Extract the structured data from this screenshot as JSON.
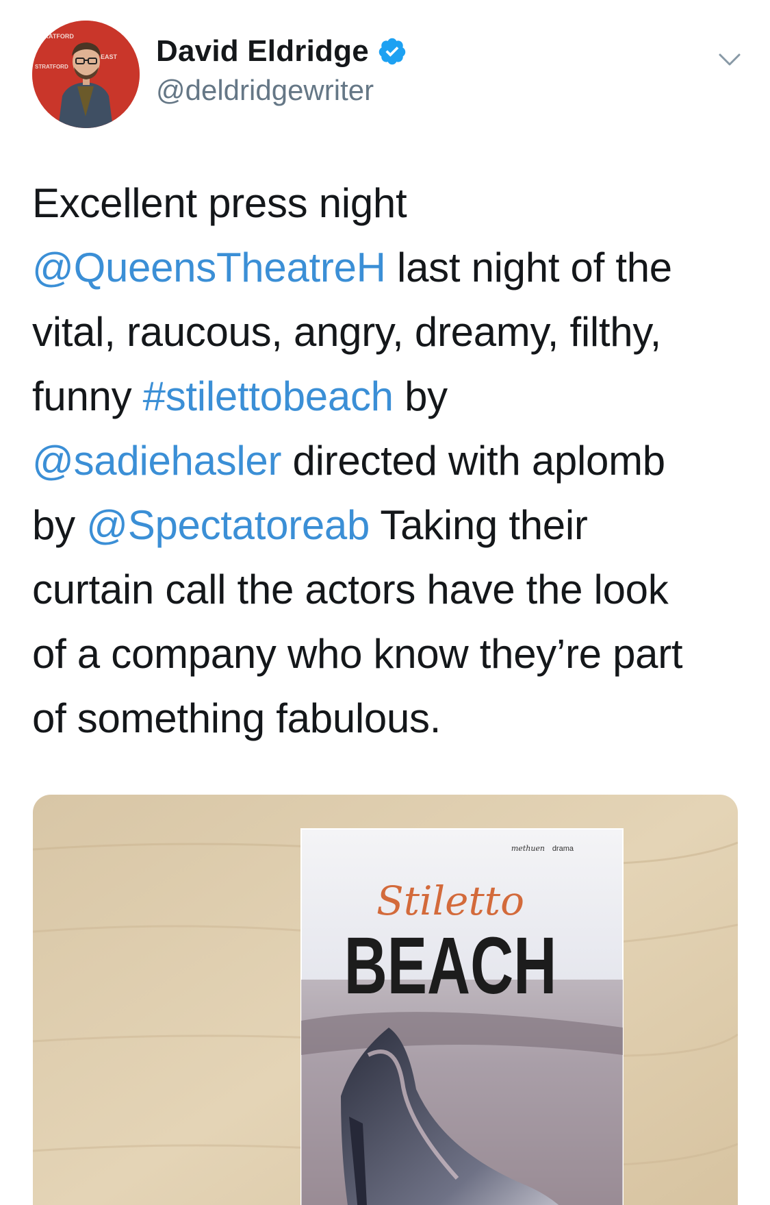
{
  "author": {
    "display_name": "David Eldridge",
    "handle": "@deldridgewriter",
    "verified": true,
    "avatar_backdrop_text": [
      "STRATFORD",
      "EAST"
    ]
  },
  "tweet": {
    "lines": [
      [
        {
          "text": "Excellent press night"
        }
      ],
      [
        {
          "text": "@QueensTheatreH",
          "link": true
        },
        {
          "text": " last night of the"
        }
      ],
      [
        {
          "text": "vital, raucous, angry, dreamy, filthy,"
        }
      ],
      [
        {
          "text": "funny "
        },
        {
          "text": "#stilettobeach",
          "link": true
        },
        {
          "text": " by"
        }
      ],
      [
        {
          "text": "@sadiehasler",
          "link": true
        },
        {
          "text": " directed with aplomb"
        }
      ],
      [
        {
          "text": "by "
        },
        {
          "text": "@Spectatoreab",
          "link": true
        },
        {
          "text": " Taking their"
        }
      ],
      [
        {
          "text": "curtain call the actors have the look"
        }
      ],
      [
        {
          "text": "of a company who know they’re part"
        }
      ],
      [
        {
          "text": "of something fabulous."
        }
      ]
    ]
  },
  "media": {
    "book_title_script": "Stiletto",
    "book_title_block": "BEACH",
    "publisher_left": "methuen",
    "publisher_right": "drama"
  },
  "icons": {
    "verified": "verified-badge-icon",
    "menu": "chevron-down-icon"
  },
  "colors": {
    "link": "#3b8fd6",
    "verified": "#1da1f2",
    "handle": "#657786",
    "text": "#14171a"
  }
}
